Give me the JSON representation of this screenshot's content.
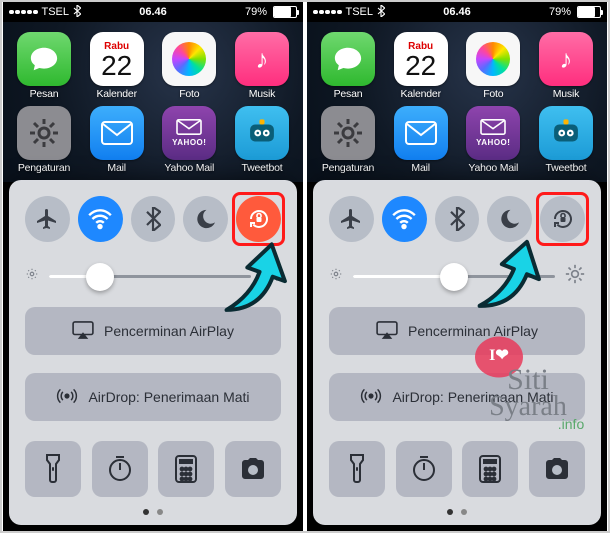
{
  "status_bar": {
    "carrier": "TSEL",
    "bluetooth": "*",
    "time": "06.46",
    "battery_pct": "79%",
    "battery_fill_pct": 79
  },
  "calendar": {
    "dow": "Rabu",
    "day": "22"
  },
  "apps_row1": [
    {
      "key": "messages",
      "label": "Pesan"
    },
    {
      "key": "calendar",
      "label": "Kalender"
    },
    {
      "key": "photos",
      "label": "Foto"
    },
    {
      "key": "music",
      "label": "Musik"
    }
  ],
  "apps_row2": [
    {
      "key": "settings",
      "label": "Pengaturan"
    },
    {
      "key": "mail",
      "label": "Mail"
    },
    {
      "key": "yahoo",
      "label": "Yahoo Mail"
    },
    {
      "key": "tweetbot",
      "label": "Tweetbot"
    }
  ],
  "control_center": {
    "toggles": [
      "airplane",
      "wifi",
      "bluetooth",
      "dnd",
      "rotation-lock"
    ],
    "brightness_pct_left": 25,
    "brightness_pct_right": 50,
    "airplay_label": "Pencerminan AirPlay",
    "airdrop_label": "AirDrop: Penerimaan Mati",
    "shortcuts": [
      "flashlight",
      "timer",
      "calculator",
      "camera"
    ]
  },
  "watermark": {
    "line1": "Siti",
    "line2": "Syarah",
    "line3": ".info"
  }
}
